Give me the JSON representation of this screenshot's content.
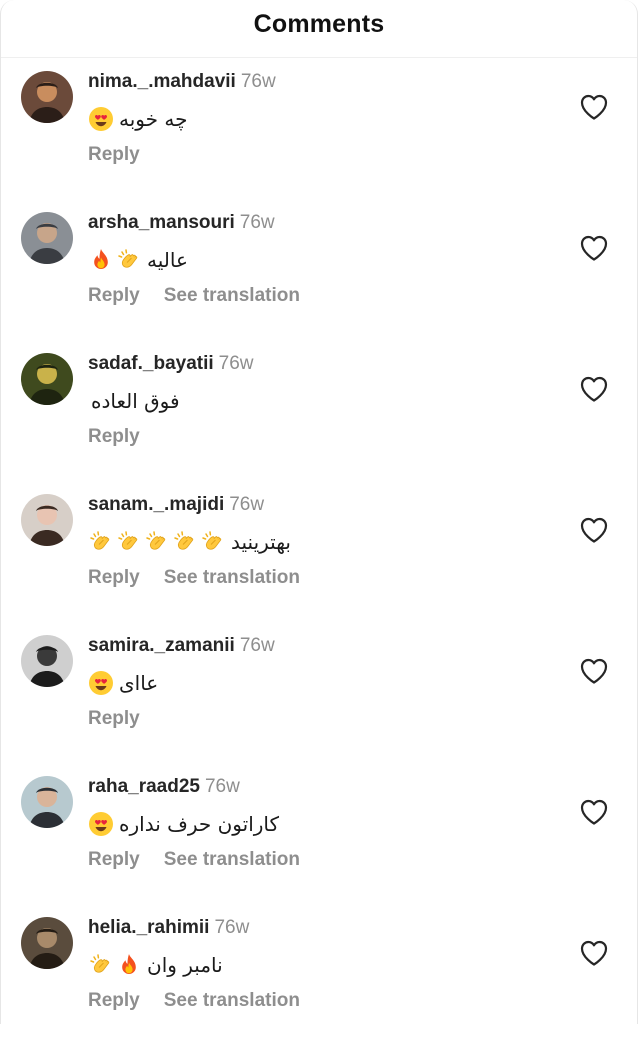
{
  "header": {
    "title": "Comments"
  },
  "actions": {
    "reply_label": "Reply",
    "translate_label": "See translation"
  },
  "colors": {
    "text_primary": "#262626",
    "text_secondary": "#8e8e8e",
    "divider": "#efefef",
    "background": "#ffffff"
  },
  "icons": {
    "like": "heart-outline-icon",
    "heart_eyes": "heart-eyes-emoji",
    "clapping": "clapping-hands-emoji",
    "fire": "fire-emoji"
  },
  "comments": [
    {
      "username": "nima._.mahdavii",
      "time": "76w",
      "text": "چه خوبه",
      "emojis": [
        "heart-eyes"
      ],
      "has_translation": false
    },
    {
      "username": "arsha_mansouri",
      "time": "76w",
      "text": "عالیه",
      "emojis": [
        "fire",
        "clap"
      ],
      "has_translation": true
    },
    {
      "username": "sadaf._bayatii",
      "time": "76w",
      "text": "فوق العاده",
      "emojis": [],
      "has_translation": false
    },
    {
      "username": "sanam._.majidi",
      "time": "76w",
      "text": "بهترینید",
      "emojis": [
        "clap",
        "clap",
        "clap",
        "clap",
        "clap"
      ],
      "has_translation": true
    },
    {
      "username": "samira._zamanii",
      "time": "76w",
      "text": "عاای",
      "emojis": [
        "heart-eyes"
      ],
      "has_translation": false
    },
    {
      "username": "raha_raad25",
      "time": "76w",
      "text": "کاراتون حرف نداره",
      "emojis": [
        "heart-eyes"
      ],
      "has_translation": true
    },
    {
      "username": "helia._rahimii",
      "time": "76w",
      "text": "نامبر وان",
      "emojis": [
        "clap",
        "fire"
      ],
      "has_translation": true
    }
  ]
}
